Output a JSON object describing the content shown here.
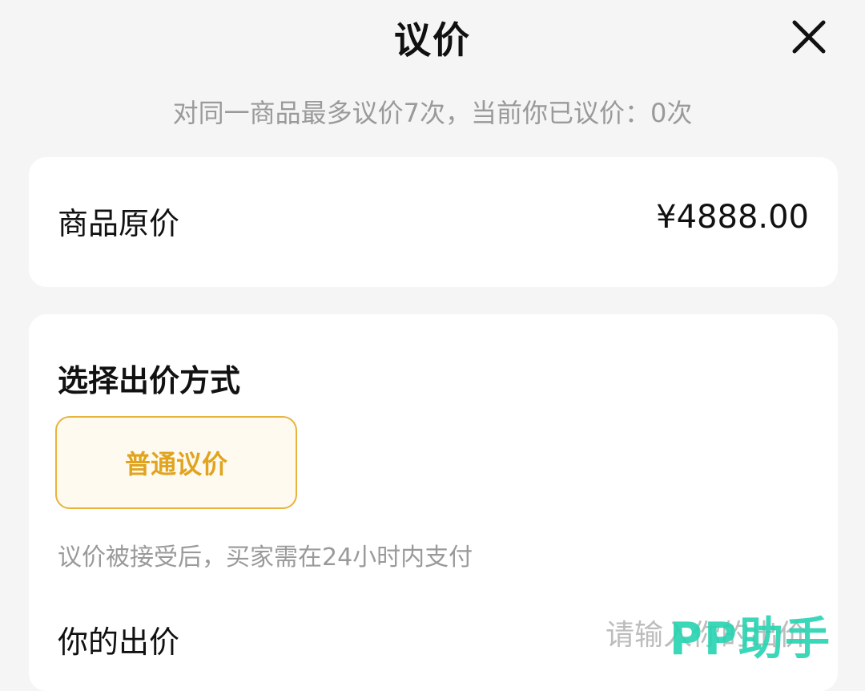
{
  "header": {
    "title": "议价",
    "close_icon": "close-icon"
  },
  "subtitle": "对同一商品最多议价7次，当前你已议价：0次",
  "original_price": {
    "label": "商品原价",
    "value": "¥4888.00"
  },
  "bid_method": {
    "title": "选择出价方式",
    "options": [
      {
        "label": "普通议价",
        "selected": true
      }
    ],
    "note": "议价被接受后，买家需在24小时内支付"
  },
  "your_offer": {
    "label": "你的出价",
    "placeholder": "请输入你的出价",
    "value": ""
  },
  "watermark": "PP助手",
  "colors": {
    "accent": "#e0a41f",
    "accent_border": "#e7b33d",
    "accent_bg": "#fffaf0",
    "background": "#f5f5f5",
    "card": "#ffffff",
    "muted_text": "#9a9a9a",
    "watermark": "#2ad4b2"
  }
}
